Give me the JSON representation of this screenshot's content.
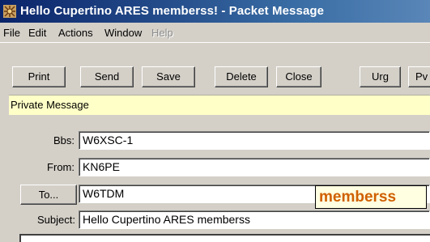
{
  "window": {
    "title": "Hello Cupertino ARES memberss! - Packet Message"
  },
  "menu": {
    "file": "File",
    "edit": "Edit",
    "actions": "Actions",
    "window": "Window",
    "help": "Help"
  },
  "toolbar": {
    "print": "Print",
    "send": "Send",
    "save": "Save",
    "delete": "Delete",
    "close": "Close",
    "urg": "Urg",
    "pv": "Pv"
  },
  "banner": {
    "text": "Private Message"
  },
  "form": {
    "bbs_label": "Bbs:",
    "bbs_value": "W6XSC-1",
    "from_label": "From:",
    "from_value": "KN6PE",
    "to_button": "To...",
    "to_value": "W6TDM",
    "subject_label": "Subject:",
    "subject_value": "Hello Cupertino ARES memberss"
  },
  "tooltip": {
    "text": "memberss"
  },
  "colors": {
    "titlebar": "#0a246a",
    "banner": "#ffffc8",
    "tooltip_text": "#d06000"
  },
  "icons": {
    "app": "packet-app-icon"
  }
}
